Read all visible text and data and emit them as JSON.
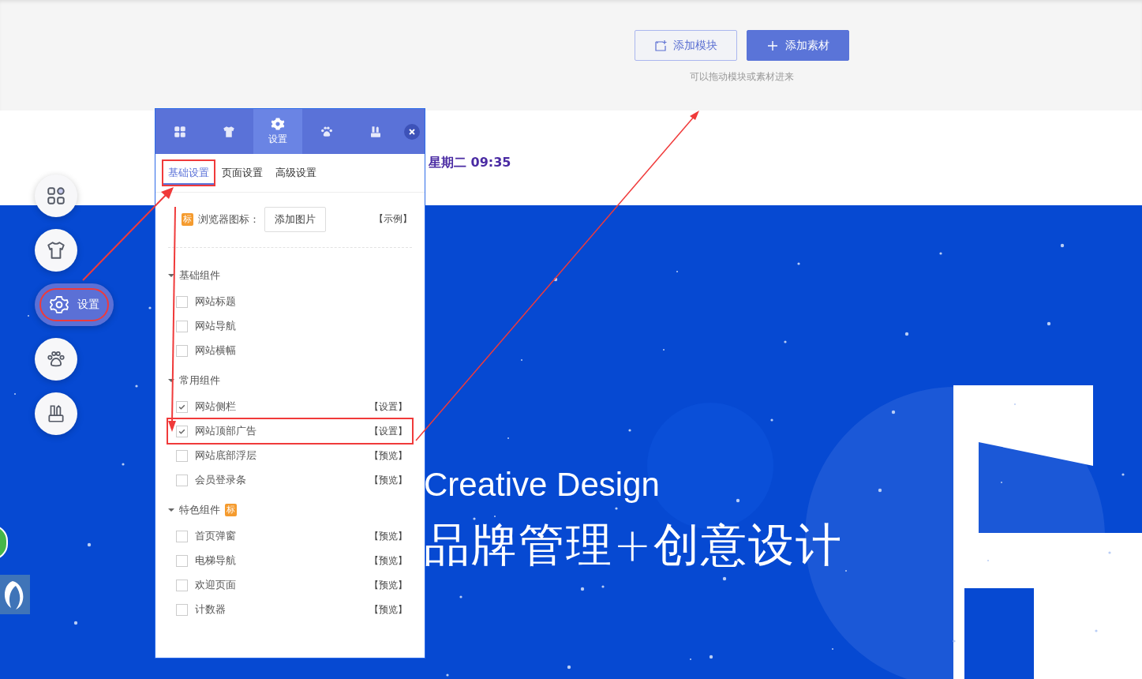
{
  "top_bar": {
    "buttons": [
      {
        "label": "添加模块",
        "kind": "outline"
      },
      {
        "label": "添加素材",
        "kind": "primary"
      }
    ],
    "hint": "可以拖动模块或素材进来"
  },
  "header": {
    "datetime": "星期二 09:35"
  },
  "banner": {
    "title": "Creative Design",
    "subtitle": "品牌管理+创意设计"
  },
  "toolbar": {
    "items": [
      {
        "kind": "grid",
        "selected": false,
        "highlighted": false
      },
      {
        "kind": "shirt",
        "selected": false,
        "highlighted": false
      },
      {
        "kind": "gear",
        "label": "设置",
        "selected": true,
        "highlighted": true
      },
      {
        "kind": "paw",
        "selected": false,
        "highlighted": false
      },
      {
        "kind": "tools",
        "selected": false,
        "highlighted": false
      }
    ]
  },
  "panel": {
    "tabs": [
      {
        "kind": "grid",
        "selected": false
      },
      {
        "kind": "shirt",
        "selected": false
      },
      {
        "kind": "gear",
        "label": "设置",
        "selected": true
      },
      {
        "kind": "paw",
        "selected": false
      },
      {
        "kind": "tools",
        "selected": false
      }
    ],
    "subtabs": [
      {
        "label": "基础设置",
        "selected": true,
        "highlighted": true
      },
      {
        "label": "页面设置",
        "selected": false,
        "highlighted": false
      },
      {
        "label": "高级设置",
        "selected": false,
        "highlighted": false
      }
    ],
    "icon_row": {
      "badge": "标",
      "label": "浏览器图标：",
      "button": "添加图片",
      "link": "【示例】"
    },
    "groups": [
      {
        "title": "基础组件",
        "expanded": true,
        "items": [
          {
            "name": "网站标题",
            "checked": false,
            "highlighted": false
          },
          {
            "name": "网站导航",
            "checked": false,
            "highlighted": false
          },
          {
            "name": "网站横幅",
            "checked": false,
            "highlighted": false
          }
        ]
      },
      {
        "title": "常用组件",
        "expanded": true,
        "items": [
          {
            "name": "网站侧栏",
            "checked": true,
            "action": "【设置】",
            "highlighted": false
          },
          {
            "name": "网站顶部广告",
            "checked": true,
            "action": "【设置】",
            "highlighted": true
          },
          {
            "name": "网站底部浮层",
            "checked": false,
            "action": "【预览】",
            "highlighted": false
          },
          {
            "name": "会员登录条",
            "checked": false,
            "action": "【预览】",
            "highlighted": false
          }
        ]
      },
      {
        "title": "特色组件",
        "badge": "标",
        "expanded": true,
        "items": [
          {
            "name": "首页弹窗",
            "checked": false,
            "action": "【预览】",
            "highlighted": false
          },
          {
            "name": "电梯导航",
            "checked": false,
            "action": "【预览】",
            "highlighted": false
          },
          {
            "name": "欢迎页面",
            "checked": false,
            "action": "【预览】",
            "highlighted": false
          },
          {
            "name": "计数器",
            "checked": false,
            "action": "【预览】",
            "highlighted": false
          }
        ]
      }
    ]
  }
}
